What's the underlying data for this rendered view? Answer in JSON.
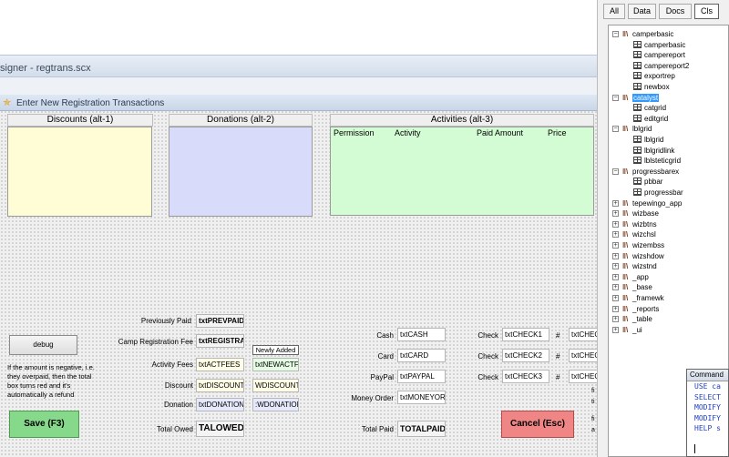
{
  "designer": {
    "title": "signer - regtrans.scx"
  },
  "form": {
    "title": "Enter New Registration Transactions",
    "sections": {
      "discounts": "Discounts  (alt-1)",
      "donations": "Donations  (alt-2)",
      "activities": "Activities  (alt-3)"
    },
    "activity_columns": [
      "Permission",
      "Activity",
      "Paid Amount",
      "Price"
    ],
    "fees": {
      "previously_paid_label": "Previously Paid",
      "previously_paid_value": "txtPREVPAID",
      "camp_registration_label": "Camp Registration Fee",
      "camp_registration_value": "txtREGISTRAI",
      "newly_added_label": "Newly Added",
      "activity_fees_label": "Activity Fees",
      "activity_fees_value": "txtACTFEES",
      "activity_fees_new": "txtNEWACTFE",
      "discount_label": "Discount",
      "discount_value": "txtDISCOUNT",
      "discount_new": "WDISCOUNT",
      "donation_label": "Donation",
      "donation_value": "txtDONATION",
      "donation_new": ":WDONATION",
      "total_owed_label": "Total Owed",
      "total_owed_value": "TALOWED"
    },
    "payments": {
      "cash_label": "Cash",
      "cash_value": "txtCASH",
      "card_label": "Card",
      "card_value": "txtCARD",
      "paypal_label": "PayPal",
      "paypal_value": "txtPAYPAL",
      "money_order_label": "Money Order",
      "money_order_value": "txtMONEYORD",
      "total_paid_label": "Total Paid",
      "total_paid_value": "TOTALPAID",
      "check_label": "Check",
      "checks": [
        "txtCHECK1",
        "txtCHECK2",
        "txtCHECK3"
      ],
      "hash": "#",
      "check_nums": [
        "txtCHEC",
        "txtCHEC",
        "txtCHEC"
      ]
    },
    "debug_label": "debug",
    "debug_note": "If the amount is negative, i.e. they overpaid, then the total box turns red and it's automatically a refund",
    "save_label": "Save (F3)",
    "cancel_label": "Cancel (Esc)",
    "clipped_fragments": [
      "fi",
      "ti",
      "fi",
      "a"
    ]
  },
  "tabs": [
    "All",
    "Data",
    "Docs",
    "Cls"
  ],
  "tree": [
    {
      "label": "camperbasic",
      "level": 0,
      "expanded": true,
      "icon": "library-icon"
    },
    {
      "label": "camperbasic",
      "level": 1,
      "icon": "form-class-icon"
    },
    {
      "label": "campereport",
      "level": 1,
      "icon": "class-icon"
    },
    {
      "label": "campereport2",
      "level": 1,
      "icon": "class-icon"
    },
    {
      "label": "exportrep",
      "level": 1,
      "icon": "class-icon"
    },
    {
      "label": "newbox",
      "level": 1,
      "icon": "label-class-icon"
    },
    {
      "label": "catalyst",
      "level": 0,
      "expanded": true,
      "selected": true,
      "icon": "library-icon"
    },
    {
      "label": "catgrid",
      "level": 1,
      "icon": "class-icon"
    },
    {
      "label": "editgrid",
      "level": 1,
      "icon": "class-icon"
    },
    {
      "label": "lblgrid",
      "level": 0,
      "expanded": true,
      "icon": "library-icon"
    },
    {
      "label": "lblgrid",
      "level": 1,
      "icon": "class-icon"
    },
    {
      "label": "lblgridlink",
      "level": 1,
      "icon": "class-icon"
    },
    {
      "label": "lblsteticgrid",
      "level": 1,
      "icon": "class-icon"
    },
    {
      "label": "progressbarex",
      "level": 0,
      "expanded": true,
      "icon": "library-icon"
    },
    {
      "label": "pbbar",
      "level": 1,
      "icon": "class-icon"
    },
    {
      "label": "progressbar",
      "level": 1,
      "icon": "class-icon"
    },
    {
      "label": "tepewingo_app",
      "level": 0,
      "icon": "library-icon"
    },
    {
      "label": "wizbase",
      "level": 0,
      "icon": "library-icon"
    },
    {
      "label": "wizbtns",
      "level": 0,
      "icon": "library-icon"
    },
    {
      "label": "wizchsl",
      "level": 0,
      "icon": "library-icon"
    },
    {
      "label": "wizembss",
      "level": 0,
      "icon": "library-icon"
    },
    {
      "label": "wizshdow",
      "level": 0,
      "icon": "library-icon"
    },
    {
      "label": "wizstnd",
      "level": 0,
      "icon": "library-icon"
    },
    {
      "label": "_app",
      "level": 0,
      "icon": "library-icon"
    },
    {
      "label": "_base",
      "level": 0,
      "icon": "library-icon"
    },
    {
      "label": "_framewk",
      "level": 0,
      "icon": "library-icon"
    },
    {
      "label": "_reports",
      "level": 0,
      "icon": "library-icon"
    },
    {
      "label": "_table",
      "level": 0,
      "icon": "library-icon"
    },
    {
      "label": "_ui",
      "level": 0,
      "icon": "library-icon"
    }
  ],
  "command": {
    "title": "Command",
    "lines": [
      "USE ca",
      "SELECT",
      "MODIFY",
      "MODIFY",
      "HELP s"
    ]
  },
  "colors": {
    "discounts_bg": "#fffdd6",
    "donations_bg": "#d8dcfa",
    "activities_bg": "#d4fcd4",
    "save_bg": "#86d98a",
    "cancel_bg": "#f08585"
  }
}
